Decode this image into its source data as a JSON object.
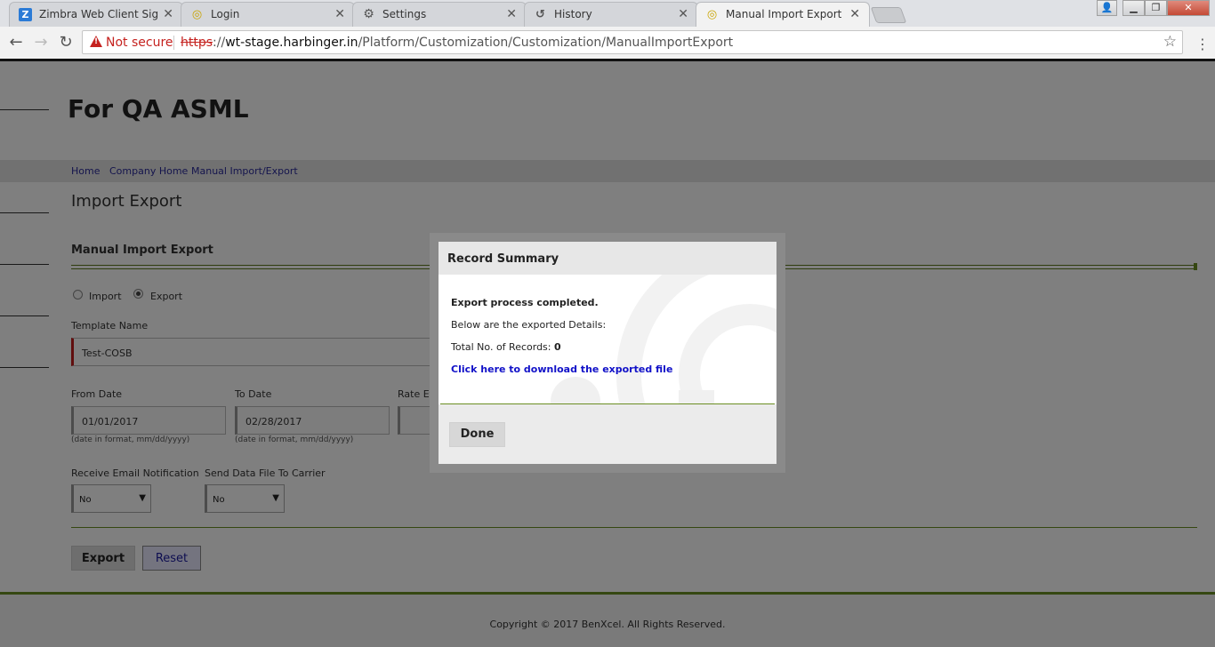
{
  "browser": {
    "tabs": [
      {
        "title": "Zimbra Web Client Sign In",
        "icon": "zimbra-icon"
      },
      {
        "title": "Login",
        "icon": "globe-icon"
      },
      {
        "title": "Settings",
        "icon": "gear-icon"
      },
      {
        "title": "History",
        "icon": "history-icon"
      },
      {
        "title": "Manual Import Export",
        "icon": "globe-icon",
        "active": true
      }
    ],
    "security_label": "Not secure",
    "url_protocol": "https",
    "url_sep": "://",
    "url_host": "wt-stage.harbinger.in",
    "url_path": "/Platform/Customization/Customization/ManualImportExport"
  },
  "page": {
    "company_name": "For QA ASML",
    "breadcrumbs": [
      "Home",
      "Company Home",
      "Manual Import/Export"
    ],
    "title": "Import Export",
    "section_title": "Manual Import Export",
    "radios": [
      {
        "label": "Import",
        "checked": false
      },
      {
        "label": "Export",
        "checked": true
      }
    ],
    "template_label": "Template Name",
    "template_value": "Test-COSB",
    "from_date_label": "From Date",
    "from_date_value": "01/01/2017",
    "from_date_hint": "(date in format, mm/dd/yyyy)",
    "to_date_label": "To Date",
    "to_date_value": "02/28/2017",
    "to_date_hint": "(date in format, mm/dd/yyyy)",
    "rate_label": "Rate Effe",
    "email_label": "Receive Email Notification",
    "email_value": "No",
    "carrier_label": "Send Data File To Carrier",
    "carrier_value": "No",
    "export_button": "Export",
    "reset_button": "Reset",
    "copyright": "Copyright © 2017 BenXcel. All Rights Reserved."
  },
  "modal": {
    "title": "Record Summary",
    "completed": "Export process completed.",
    "below": "Below are the exported Details:",
    "total_label": "Total No. of Records:",
    "total_value": "0",
    "link": "Click here to download the exported file",
    "done_button": "Done"
  },
  "colors": {
    "accent_green": "#6b8e23",
    "link_blue": "#1111c8",
    "required_red": "#c21c1c"
  }
}
